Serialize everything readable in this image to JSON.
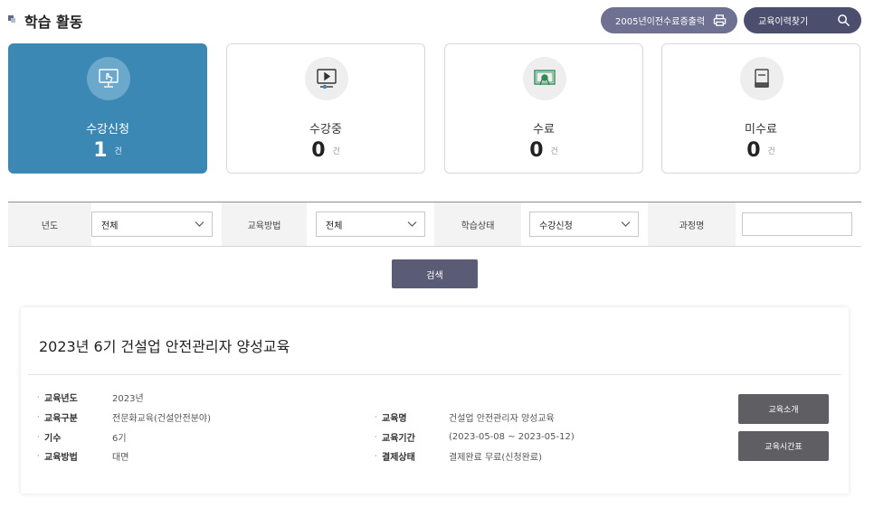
{
  "header": {
    "title": "학습 활동",
    "cert_button": "2005년이전수료증출력",
    "history_button": "교육이력찾기"
  },
  "cards": [
    {
      "label": "수강신청",
      "count": "1",
      "unit": "건",
      "icon": "touch-screen-icon",
      "active": true
    },
    {
      "label": "수강중",
      "count": "0",
      "unit": "건",
      "icon": "video-play-icon",
      "active": false
    },
    {
      "label": "수료",
      "count": "0",
      "unit": "건",
      "icon": "certificate-icon",
      "active": false
    },
    {
      "label": "미수료",
      "count": "0",
      "unit": "건",
      "icon": "document-icon",
      "active": false
    }
  ],
  "filter": {
    "year_label": "년도",
    "year_value": "전체",
    "method_label": "교육방법",
    "method_value": "전체",
    "status_label": "학습상태",
    "status_value": "수강신청",
    "course_label": "과정명",
    "course_value": "",
    "search_button": "검색"
  },
  "course": {
    "title": "2023년 6기 건설업 안전관리자 양성교육",
    "left_fields": [
      {
        "key": "교육년도",
        "value": "2023년"
      },
      {
        "key": "교육구분",
        "value": "전문화교육(건설안전분야)"
      },
      {
        "key": "기수",
        "value": "6기"
      },
      {
        "key": "교육방법",
        "value": "대면"
      }
    ],
    "right_fields": [
      {
        "key": "교육명",
        "value": "건설업 안전관리자 양성교육"
      },
      {
        "key": "교육기간",
        "value": "(2023-05-08 ~ 2023-05-12)"
      },
      {
        "key": "결제상태",
        "value": "결제완료 무료(신청완료)"
      }
    ],
    "intro_button": "교육소개",
    "schedule_button": "교육시간표"
  },
  "colors": {
    "active_card": "#3b88b5",
    "cert_button": "#6e7191",
    "history_button": "#4b4e6d",
    "search_button": "#5a5b74",
    "course_button": "#5f5f63"
  }
}
